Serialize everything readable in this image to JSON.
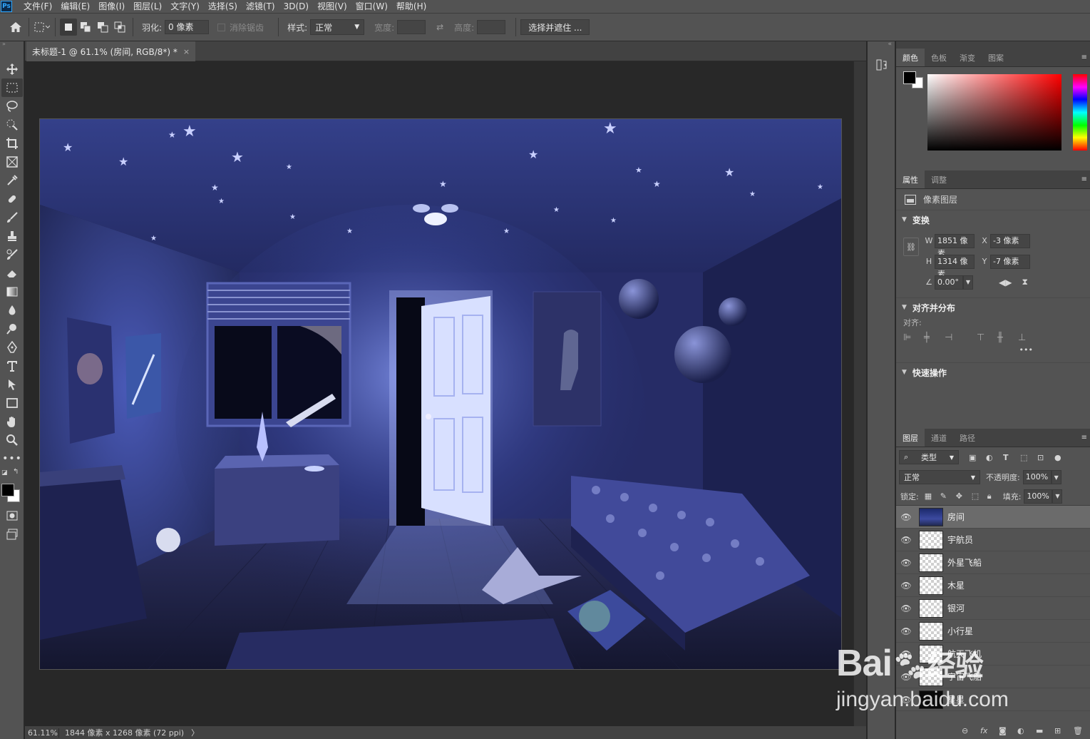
{
  "menu": [
    "文件(F)",
    "编辑(E)",
    "图像(I)",
    "图层(L)",
    "文字(Y)",
    "选择(S)",
    "滤镜(T)",
    "3D(D)",
    "视图(V)",
    "窗口(W)",
    "帮助(H)"
  ],
  "app_logo": "Ps",
  "options": {
    "feather_label": "羽化:",
    "feather_value": "0 像素",
    "antialias_label": "消除锯齿",
    "style_label": "样式:",
    "style_value": "正常",
    "width_label": "宽度:",
    "height_label": "高度:",
    "select_mask_button": "选择并遮住 ..."
  },
  "document": {
    "tab_title": "未标题-1 @ 61.1% (房间, RGB/8*) *",
    "tab_close": "×"
  },
  "status": {
    "zoom": "61.11%",
    "info": "1844 像素 x 1268 像素 (72 ppi)",
    "arrow": "〉"
  },
  "color_panel": {
    "tabs": [
      "颜色",
      "色板",
      "渐变",
      "图案"
    ],
    "foreground": "#000000",
    "background": "#ffffff"
  },
  "properties_panel": {
    "tabs": [
      "属性",
      "调整"
    ],
    "type_label": "像素图层",
    "transform_title": "变换",
    "w_label": "W",
    "w_value": "1851 像素",
    "h_label": "H",
    "h_value": "1314 像素",
    "x_label": "X",
    "x_value": "-3 像素",
    "y_label": "Y",
    "y_value": "-7 像素",
    "angle_value": "0.00°",
    "align_title": "对齐并分布",
    "align_label": "对齐:",
    "more": "•••",
    "quick_actions_title": "快速操作"
  },
  "layers_panel": {
    "tabs": [
      "图层",
      "通道",
      "路径"
    ],
    "filter_label": "类型",
    "blend_mode": "正常",
    "opacity_label": "不透明度:",
    "opacity_value": "100%",
    "lock_label": "锁定:",
    "fill_label": "填充:",
    "fill_value": "100%",
    "layers": [
      {
        "name": "房间",
        "thumb": "room",
        "selected": true
      },
      {
        "name": "宇航员",
        "thumb": "transparent"
      },
      {
        "name": "外星飞船",
        "thumb": "transparent"
      },
      {
        "name": "木星",
        "thumb": "transparent"
      },
      {
        "name": "银河",
        "thumb": "transparent"
      },
      {
        "name": "小行星",
        "thumb": "transparent"
      },
      {
        "name": "航天飞机",
        "thumb": "transparent"
      },
      {
        "name": "宇宙飞船",
        "thumb": "transparent"
      },
      {
        "name": "星星",
        "thumb": "dark"
      }
    ],
    "footer_fx": "fx"
  },
  "watermark": {
    "brand": "Bai",
    "brand_cn": "经验",
    "url": "jingyan.baidu.com"
  }
}
